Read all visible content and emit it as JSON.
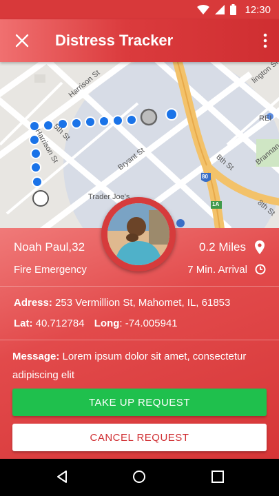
{
  "status_bar": {
    "time": "12:30"
  },
  "app_bar": {
    "title": "Distress Tracker"
  },
  "map": {
    "labels": {
      "harrison_1": "Harrison St",
      "harrison_2": "Harrison St",
      "bryant": "Bryant St",
      "trader_joes": "Trader Joe's",
      "st_8th": "8th St",
      "st_8th_b": "8th St",
      "brannan": "Brannan",
      "rei": "REI",
      "hwy_80": "80",
      "hwy_1a": "1A",
      "lington": "lington St",
      "fifth": "5th St"
    }
  },
  "person": {
    "name_age": "Noah Paul,32",
    "type": "Fire Emergency",
    "distance": "0.2 Miles",
    "arrival": "7 Min. Arrival"
  },
  "details": {
    "address_label": "Adress:",
    "address_value": "253 Vermillion St, Mahomet, IL, 61853",
    "lat_label": "Lat:",
    "lat_value": "40.712784",
    "long_label": "Long",
    "long_value": ": -74.005941",
    "message_label": "Message:",
    "message_line1": "Lorem ipsum dolor sit amet, consectetur",
    "message_line2": "adipiscing elit"
  },
  "actions": {
    "take_up": "TAKE UP REQUEST",
    "cancel": "CANCEL REQUEST"
  },
  "colors": {
    "primary": "#d63637",
    "accent_green": "#1fc04d",
    "route_blue": "#1a73e8"
  }
}
